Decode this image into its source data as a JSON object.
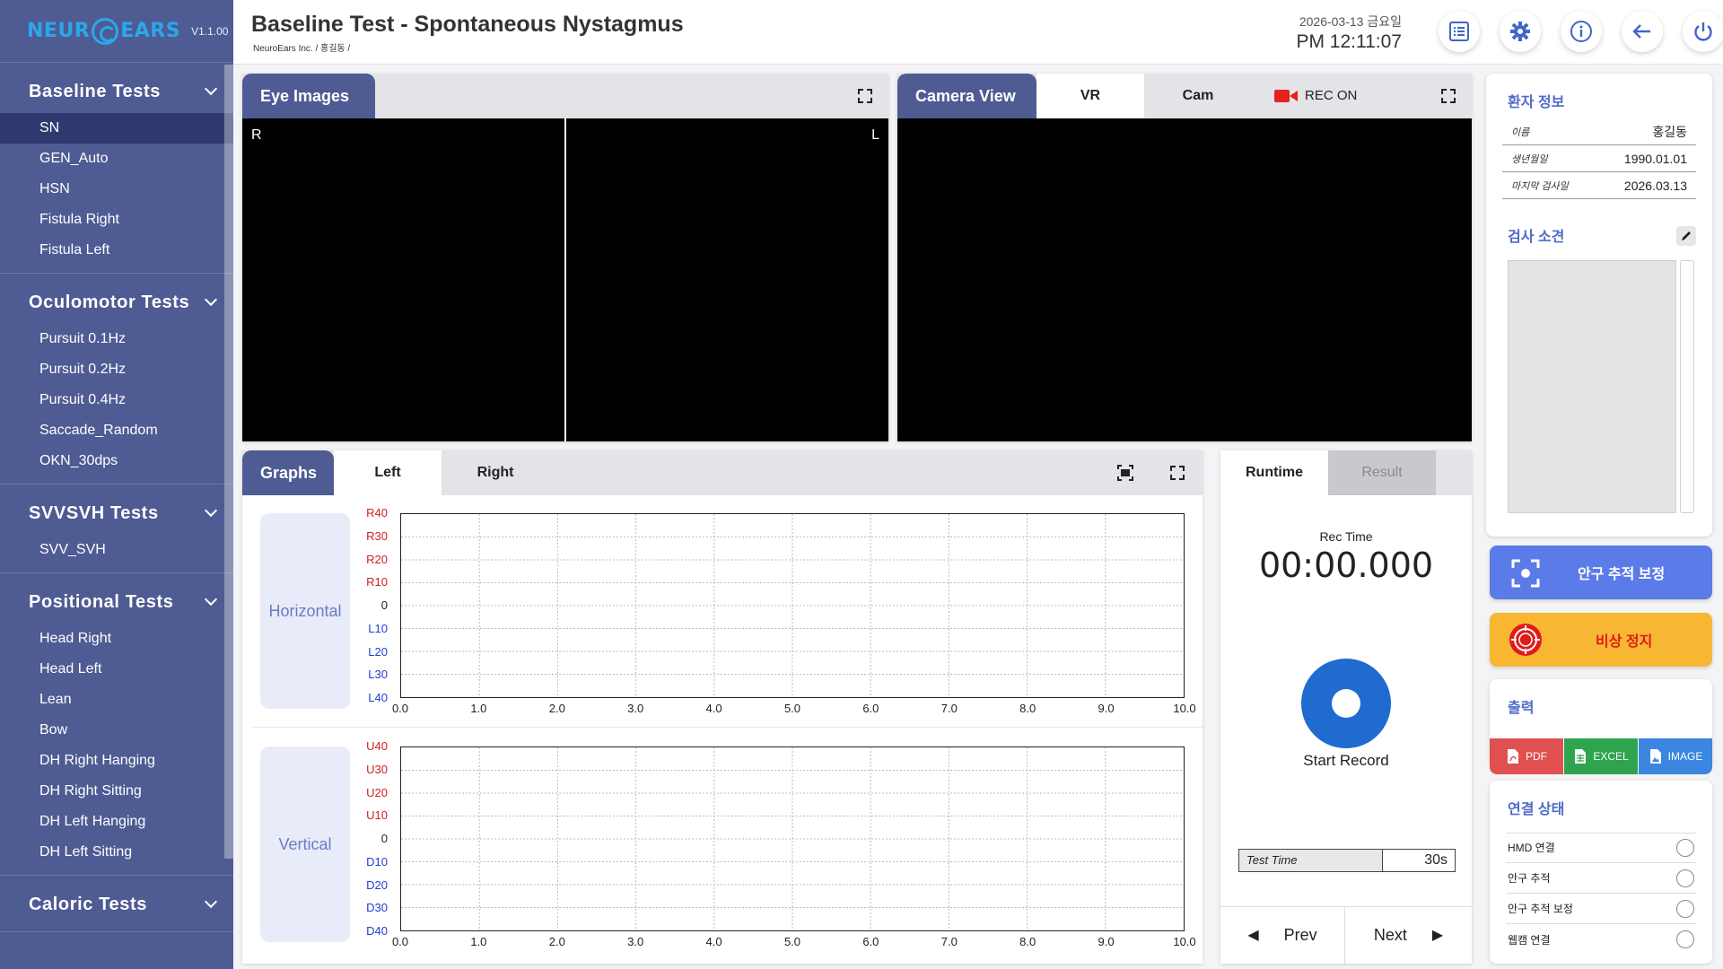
{
  "app": {
    "logo_left": "NEUR",
    "logo_right": "EARS",
    "version": "V1.1.00"
  },
  "sidebar": {
    "sections": [
      {
        "title": "Baseline Tests",
        "items": [
          "SN",
          "GEN_Auto",
          "HSN",
          "Fistula Right",
          "Fistula Left"
        ]
      },
      {
        "title": "Oculomotor Tests",
        "items": [
          "Pursuit 0.1Hz",
          "Pursuit 0.2Hz",
          "Pursuit 0.4Hz",
          "Saccade_Random",
          "OKN_30dps"
        ]
      },
      {
        "title": "SVVSVH Tests",
        "items": [
          "SVV_SVH"
        ]
      },
      {
        "title": "Positional Tests",
        "items": [
          "Head Right",
          "Head Left",
          "Lean",
          "Bow",
          "DH Right Hanging",
          "DH Right Sitting",
          "DH Left Hanging",
          "DH Left Sitting"
        ]
      },
      {
        "title": "Caloric Tests",
        "items": []
      }
    ],
    "active_item": "SN"
  },
  "header": {
    "title": "Baseline Test - Spontaneous Nystagmus",
    "breadcrumb": "NeuroEars Inc. / 홍길동 /",
    "date": "2026-03-13 금요일",
    "time": "PM 12:11:07",
    "buttons": [
      "list-icon",
      "gear-icon",
      "info-icon",
      "back-arrow-icon",
      "power-icon"
    ]
  },
  "eye_images": {
    "label": "Eye Images",
    "right_marker": "R",
    "left_marker": "L"
  },
  "camera_view": {
    "label": "Camera View",
    "tabs": [
      "VR",
      "Cam"
    ],
    "active_tab": "VR",
    "rec_label": "REC ON",
    "rec_color": "#e52020"
  },
  "graphs": {
    "label": "Graphs",
    "tabs": [
      "Left",
      "Right"
    ],
    "active_tab": "Left",
    "horizontal": {
      "label": "Horizontal",
      "y_ticks": [
        "R40",
        "R30",
        "R20",
        "R10",
        "0",
        "L10",
        "L20",
        "L30",
        "L40"
      ]
    },
    "vertical": {
      "label": "Vertical",
      "y_ticks": [
        "U40",
        "U30",
        "U20",
        "U10",
        "0",
        "D10",
        "D20",
        "D30",
        "D40"
      ]
    },
    "x_ticks": [
      "0.0",
      "1.0",
      "2.0",
      "3.0",
      "4.0",
      "5.0",
      "6.0",
      "7.0",
      "8.0",
      "9.0",
      "10.0"
    ]
  },
  "runtime": {
    "tabs": [
      "Runtime",
      "Result"
    ],
    "active_tab": "Runtime",
    "rec_time_label": "Rec Time",
    "rec_time": "00:00.000",
    "start_label": "Start Record",
    "test_time_label": "Test Time",
    "test_time_value": "30s",
    "prev_label": "Prev",
    "next_label": "Next"
  },
  "patient_info": {
    "title": "환자 정보",
    "rows": [
      {
        "key": "이름",
        "value": "홍길동"
      },
      {
        "key": "생년월일",
        "value": "1990.01.01"
      },
      {
        "key": "마지막 검사일",
        "value": "2026.03.13"
      }
    ]
  },
  "exam_notes": {
    "title": "검사 소견"
  },
  "actions": {
    "calibration_label": "안구 추적 보정",
    "calibration_color": "#5b7be8",
    "emergency_label": "비상 정지",
    "emergency_color": "#f7b733"
  },
  "export": {
    "title": "출력",
    "buttons": [
      {
        "label": "PDF",
        "color": "#e05050"
      },
      {
        "label": "EXCEL",
        "color": "#2ea44f"
      },
      {
        "label": "IMAGE",
        "color": "#3a86e0"
      }
    ]
  },
  "connection": {
    "title": "연결 상태",
    "rows": [
      "HMD 연결",
      "안구 추적",
      "안구 추적 보정",
      "웹캠 연결"
    ]
  }
}
